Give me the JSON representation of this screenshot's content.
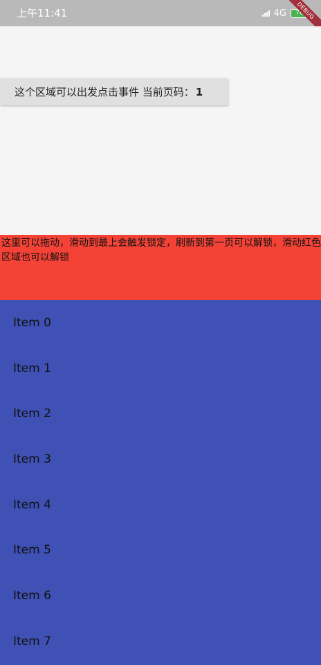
{
  "status_bar": {
    "time": "上午11:41",
    "network": "4G",
    "battery": "76",
    "debug_label": "DEBUG"
  },
  "top_area": {
    "button_text": "这个区域可以出发点击事件 当前页码：",
    "page_number": "1"
  },
  "drag_area": {
    "text": "这里可以拖动，滑动到最上会触发锁定，刷新到第一页可以解锁，滑动红色区域也可以解锁"
  },
  "list": {
    "items": [
      "Item 0",
      "Item 1",
      "Item 2",
      "Item 3",
      "Item 4",
      "Item 5",
      "Item 6",
      "Item 7"
    ]
  },
  "colors": {
    "status_bar": "#b9b9b9",
    "background": "#f5f5f5",
    "drag_area": "#f44336",
    "list_background": "#3f51b5"
  }
}
